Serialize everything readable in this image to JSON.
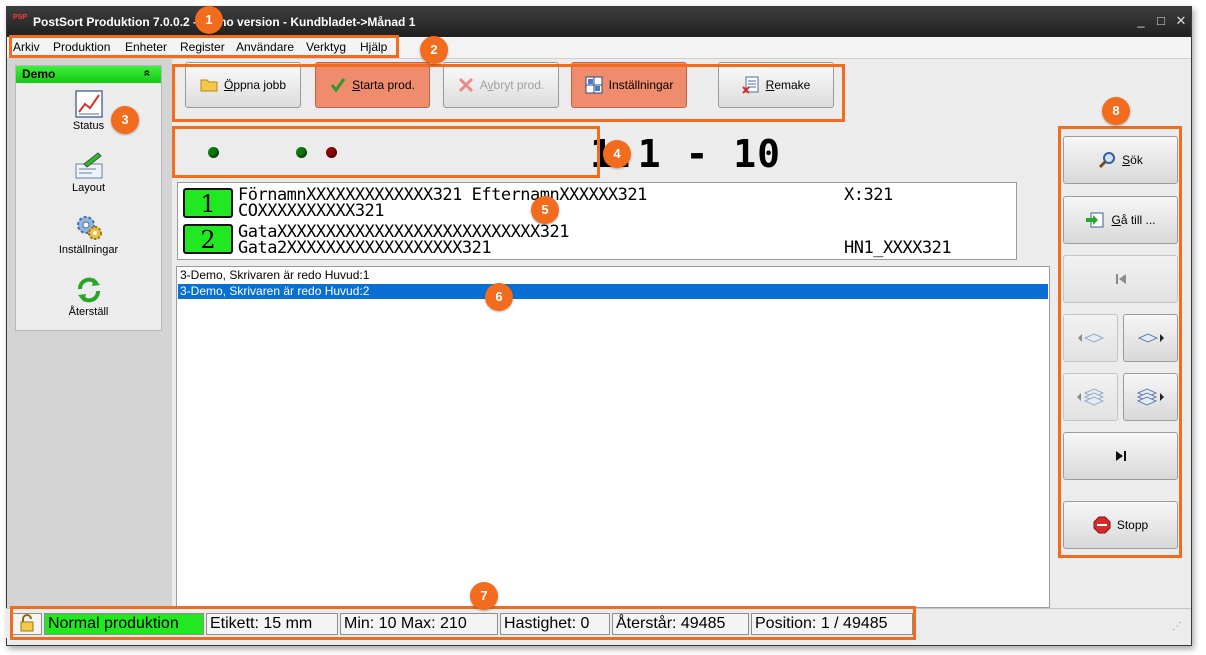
{
  "window": {
    "title": "PostSort Produktion 7.0.0.2 - Demo version  -  Kundbladet->Månad 1",
    "app_icon_text": "PSP",
    "controls": {
      "minimize": "_",
      "maximize": "□",
      "close": "✕"
    }
  },
  "menu": [
    "Arkiv",
    "Produktion",
    "Enheter",
    "Register",
    "Användare",
    "Verktyg",
    "Hjälp"
  ],
  "sidebar": {
    "group_title": "Demo",
    "collapse_glyph": "«",
    "items": [
      {
        "label": "Status",
        "icon": "chart-icon"
      },
      {
        "label": "Layout",
        "icon": "layout-icon"
      },
      {
        "label": "Inställningar",
        "icon": "gears-icon"
      },
      {
        "label": "Återställ",
        "icon": "refresh-icon"
      }
    ]
  },
  "toolbar": {
    "open_job": {
      "prefix": "",
      "underline": "Ö",
      "rest": "ppna jobb"
    },
    "start_prod": {
      "underline": "S",
      "rest": "tarta prod."
    },
    "abort_prod": {
      "prefix": "A",
      "underline": "v",
      "rest": "bryt prod."
    },
    "settings": {
      "label": "Inställningar"
    },
    "remake": {
      "underline": "R",
      "rest": "emake"
    }
  },
  "counter": {
    "text": "1:1 - 10"
  },
  "leds": [
    {
      "name": "led-green-1",
      "color": "#0a7a0a"
    },
    {
      "name": "led-green-2",
      "color": "#0a7a0a"
    },
    {
      "name": "led-red",
      "color": "#8a0a0a"
    }
  ],
  "label_preview": {
    "rows": [
      {
        "num": "1",
        "line1": "FörnamnXXXXXXXXXXXXX321 EfternamnXXXXXX321",
        "line1_right": "X:321",
        "line2": "COXXXXXXXXXX321",
        "line2_right": ""
      },
      {
        "num": "2",
        "line1": "GataXXXXXXXXXXXXXXXXXXXXXXXXXXX321",
        "line1_right": "",
        "line2": "Gata2XXXXXXXXXXXXXXXXXX321",
        "line2_right": "HN1_XXXX321"
      }
    ]
  },
  "log": [
    {
      "text": "3-Demo, Skrivaren är redo Huvud:1",
      "selected": false
    },
    {
      "text": "3-Demo, Skrivaren är redo Huvud:2",
      "selected": true
    }
  ],
  "right_panel": {
    "search": {
      "underline": "S",
      "rest": "ök"
    },
    "goto": {
      "underline": "G",
      "rest": "å till ..."
    },
    "stop": {
      "label": "Stopp"
    }
  },
  "statusbar": {
    "mode": "Normal produktion",
    "label_size": "Etikett: 15 mm",
    "minmax": "Min: 10  Max: 210",
    "speed": "Hastighet: 0",
    "remaining": "Återstår: 49485",
    "position": "Position: 1 / 49485"
  },
  "callouts": [
    "1",
    "2",
    "3",
    "4",
    "5",
    "6",
    "7",
    "8"
  ],
  "colors": {
    "accent": "#f36b1c",
    "green": "#22e822",
    "selection": "#0a6fd3",
    "hot_button": "#f08c6e"
  }
}
